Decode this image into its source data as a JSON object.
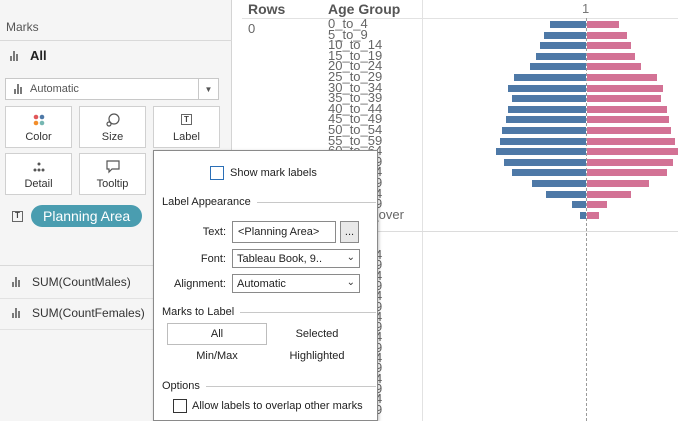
{
  "marks_card": {
    "title": "Marks",
    "all_label": "All",
    "mark_type": "Automatic",
    "buttons": {
      "color": "Color",
      "size": "Size",
      "label": "Label",
      "detail": "Detail",
      "tooltip": "Tooltip"
    },
    "label_pill": "Planning Area",
    "fields": [
      "SUM(CountMales)",
      "SUM(CountFemales)"
    ]
  },
  "view": {
    "rows_header": "Rows",
    "age_header": "Age Group",
    "column_header": "1",
    "row_value": "0",
    "age_groups_top": [
      "0_to_4",
      "5_to_9",
      "10_to_14",
      "15_to_19",
      "20_to_24",
      "25_to_29",
      "30_to_34",
      "35_to_39",
      "40_to_44",
      "45_to_49",
      "50_to_54",
      "55_to_59",
      "60_to_64",
      "65_to_69",
      "70_to_74",
      "75_to_79",
      "80_to_84",
      "85_to_89",
      "90_and_over"
    ],
    "age_groups_bottom": [
      "10_to_14",
      "15_to_19",
      "20_to_24",
      "25_to_29",
      "30_to_34",
      "35_to_39",
      "40_to_44",
      "45_to_49",
      "50_to_54",
      "55_to_59",
      "60_to_64",
      "65_to_69",
      "70_to_74",
      "75_to_79",
      "80_to_84",
      "85_to_89"
    ]
  },
  "chart_data": {
    "type": "bar",
    "orientation": "horizontal",
    "categories": [
      "0_to_4",
      "5_to_9",
      "10_to_14",
      "15_to_19",
      "20_to_24",
      "25_to_29",
      "30_to_34",
      "35_to_39",
      "40_to_44",
      "45_to_49",
      "50_to_54",
      "55_to_59",
      "60_to_64",
      "65_to_69",
      "70_to_74",
      "75_to_79",
      "80_to_84",
      "85_to_89",
      "90_and_over"
    ],
    "series": [
      {
        "name": "SUM(CountMales)",
        "color": "#4e79a7",
        "values": [
          36,
          42,
          46,
          50,
          56,
          72,
          78,
          74,
          78,
          80,
          84,
          86,
          90,
          82,
          74,
          54,
          40,
          14,
          6
        ]
      },
      {
        "name": "SUM(CountFemales)",
        "color": "#d37295",
        "values": [
          32,
          40,
          44,
          48,
          54,
          70,
          76,
          74,
          80,
          82,
          84,
          88,
          92,
          86,
          80,
          62,
          44,
          20,
          12
        ]
      }
    ],
    "xlim": [
      -100,
      100
    ],
    "ylabel": "Age Group"
  },
  "label_dialog": {
    "show_mark_labels": "Show mark labels",
    "appearance_header": "Label Appearance",
    "text_label": "Text:",
    "text_value": "<Planning Area>",
    "dots": "...",
    "font_label": "Font:",
    "font_value": "Tableau Book, 9..",
    "alignment_label": "Alignment:",
    "alignment_value": "Automatic",
    "marks_to_label_header": "Marks to Label",
    "options": {
      "all": "All",
      "selected": "Selected",
      "minmax": "Min/Max",
      "highlighted": "Highlighted"
    },
    "options_header": "Options",
    "overlap": "Allow labels to overlap other marks"
  }
}
